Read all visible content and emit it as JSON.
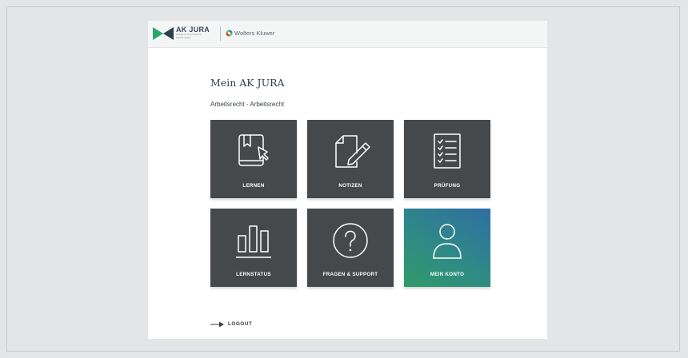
{
  "header": {
    "brand_name": "AK JURA",
    "brand_tagline": "Akademie für juristische Fachseminare",
    "partner_name": "Wolters Kluwer"
  },
  "main": {
    "title": "Mein AK JURA",
    "subtitle": "Arbeitsrecht - Arbeitsrecht",
    "tiles": [
      {
        "label": "LERNEN",
        "icon": "book-cursor-icon"
      },
      {
        "label": "NOTIZEN",
        "icon": "note-pencil-icon"
      },
      {
        "label": "PRÜFUNG",
        "icon": "checklist-icon"
      },
      {
        "label": "LERNSTATUS",
        "icon": "bar-chart-icon"
      },
      {
        "label": "FRAGEN & SUPPORT",
        "icon": "question-circle-icon"
      },
      {
        "label": "MEIN KONTO",
        "icon": "user-icon",
        "active": true
      }
    ],
    "logout_label": "LOGOUT"
  },
  "colors": {
    "tile": "#46494c",
    "tile_active_from": "#2f9a6a",
    "tile_active_to": "#2f6ea2",
    "brand_green": "#2aa86b",
    "brand_navy": "#2c3e50"
  }
}
